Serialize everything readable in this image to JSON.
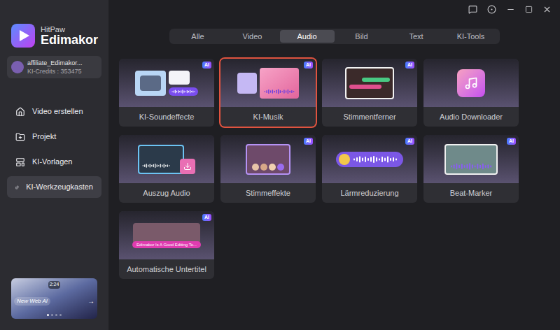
{
  "app": {
    "brand_small": "HitPaw",
    "brand": "Edimakor"
  },
  "account": {
    "name": "affiliate_Edimakor...",
    "credits": "KI-Credits : 353475"
  },
  "sidebar": {
    "items": [
      {
        "label": "Video erstellen",
        "selected": false
      },
      {
        "label": "Projekt",
        "selected": false
      },
      {
        "label": "KI-Vorlagen",
        "selected": false
      },
      {
        "label": "KI-Werkzeugkasten",
        "selected": true
      }
    ]
  },
  "banner": {
    "time": "2:24",
    "caption": "New Web AI",
    "arrow": "→",
    "dots": [
      {
        "selected": true
      },
      {
        "selected": false
      },
      {
        "selected": false
      },
      {
        "selected": false
      }
    ]
  },
  "tabs": [
    {
      "label": "Alle",
      "selected": false
    },
    {
      "label": "Video",
      "selected": false
    },
    {
      "label": "Audio",
      "selected": true
    },
    {
      "label": "Bild",
      "selected": false
    },
    {
      "label": "Text",
      "selected": false
    },
    {
      "label": "KI-Tools",
      "selected": false
    }
  ],
  "badge_text": "AI",
  "tools": [
    {
      "label": "KI-Soundeffecte",
      "kind": "soundfx",
      "ai": true,
      "highlighted": false
    },
    {
      "label": "KI-Musik",
      "kind": "music",
      "ai": true,
      "highlighted": true
    },
    {
      "label": "Stimmentferner",
      "kind": "separator",
      "ai": true,
      "highlighted": false
    },
    {
      "label": "Audio Downloader",
      "kind": "download",
      "ai": false,
      "highlighted": false
    },
    {
      "label": "Auszug Audio",
      "kind": "extract",
      "ai": false,
      "highlighted": false
    },
    {
      "label": "Stimmeffekte",
      "kind": "voices",
      "ai": true,
      "highlighted": false
    },
    {
      "label": "Lärmreduzierung",
      "kind": "noise",
      "ai": true,
      "highlighted": false
    },
    {
      "label": "Beat-Marker",
      "kind": "beat",
      "ai": true,
      "highlighted": false
    },
    {
      "label": "Automatische Untertitel",
      "kind": "subtitle",
      "ai": true,
      "highlighted": false,
      "caption": "Edimakor Is A Good Editing To..."
    }
  ]
}
